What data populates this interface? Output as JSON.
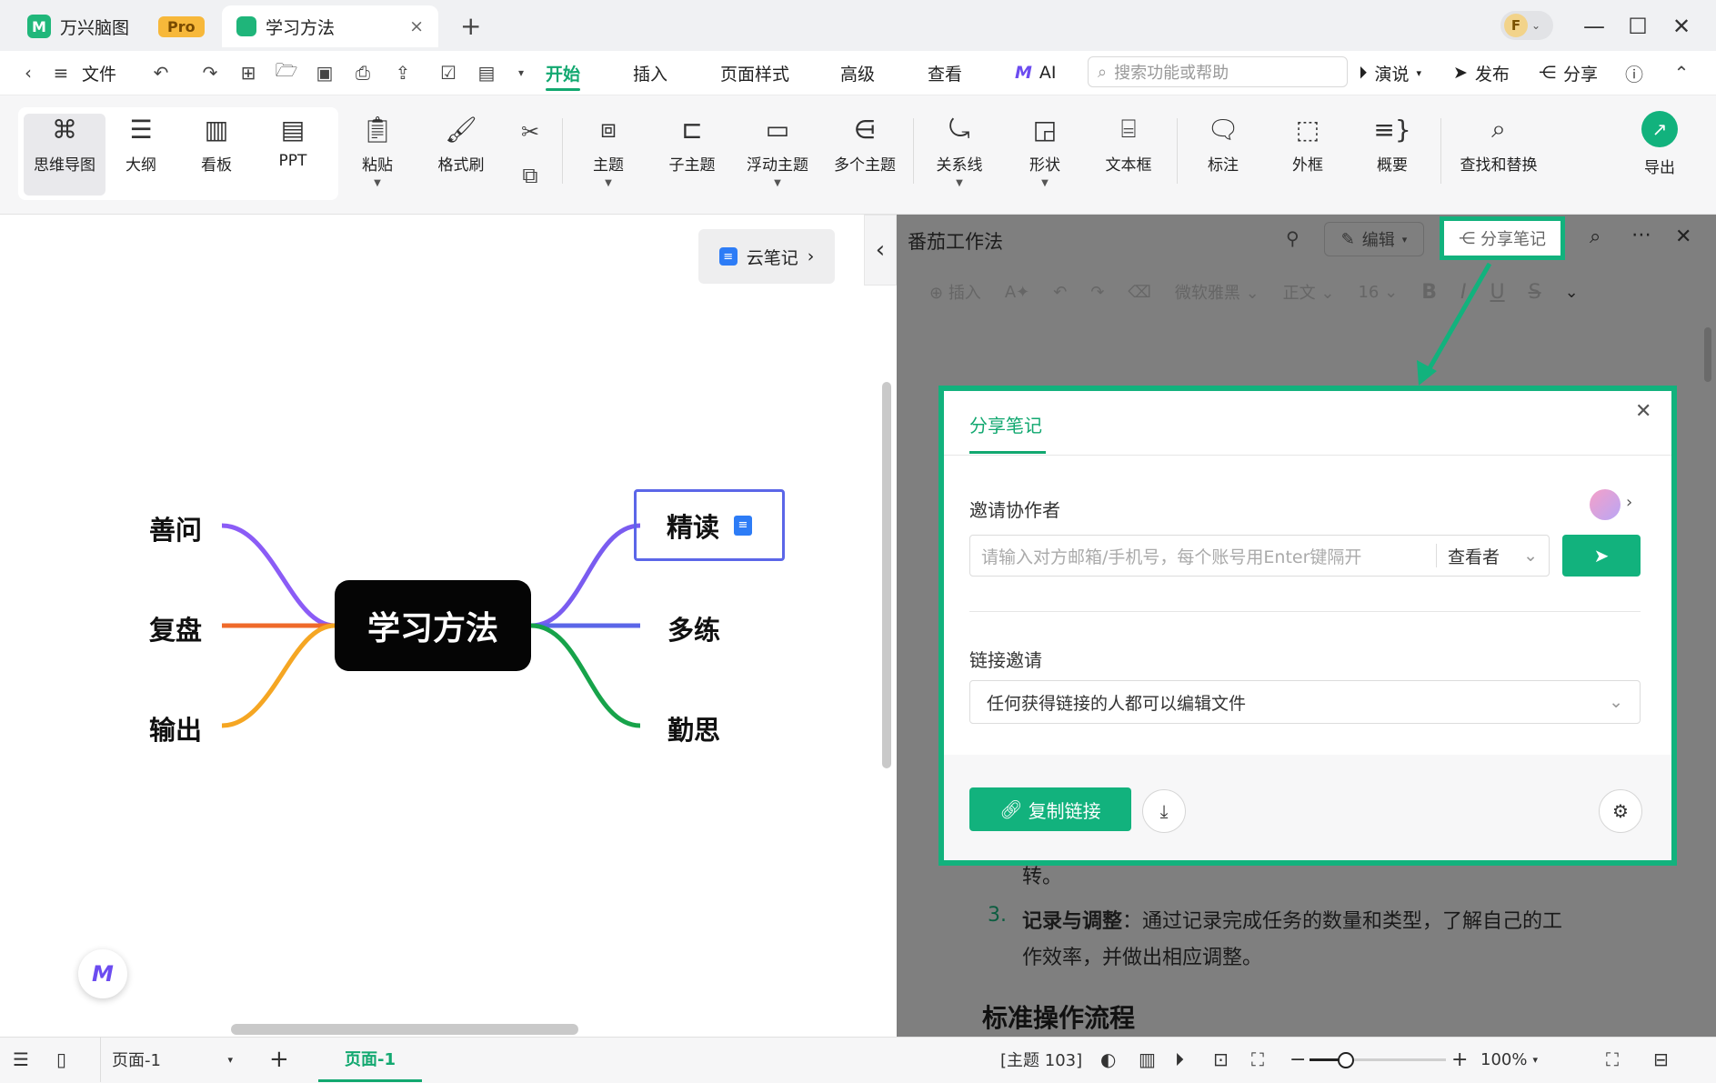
{
  "titlebar": {
    "app_name": "万兴脑图",
    "pro_badge": "Pro",
    "doc_tab": "学习方法",
    "close_tab": "×",
    "new_tab": "+",
    "avatar_letter": "F"
  },
  "menubar": {
    "file": "文件",
    "tabs": [
      "开始",
      "插入",
      "页面样式",
      "高级",
      "查看"
    ],
    "ai": "AI",
    "search_placeholder": "搜索功能或帮助",
    "present": "演说",
    "publish": "发布",
    "share": "分享"
  },
  "ribbon": {
    "views": [
      "思维导图",
      "大纲",
      "看板",
      "PPT"
    ],
    "paste": "粘贴",
    "format_painter": "格式刷",
    "topic": "主题",
    "subtopic": "子主题",
    "floating_topic": "浮动主题",
    "multiple_topics": "多个主题",
    "relationship": "关系线",
    "shape": "形状",
    "textbox": "文本框",
    "callout": "标注",
    "boundary": "外框",
    "summary": "概要",
    "find_replace": "查找和替换",
    "export": "导出"
  },
  "mindmap": {
    "root": "学习方法",
    "left": [
      "善问",
      "复盘",
      "输出"
    ],
    "right": [
      "精读",
      "多练",
      "勤思"
    ],
    "colors": {
      "shanwen": "#8b5cf6",
      "fupan": "#ef6a2a",
      "shuchu": "#f5a623",
      "jingdu": "#7a5cf0",
      "duolian": "#5b66e8",
      "qinsi": "#17a34a"
    }
  },
  "cloud_note_button": "云笔记",
  "note_panel": {
    "title": "番茄工作法",
    "edit": "编辑",
    "share_note": "分享笔记",
    "toolbar": {
      "insert": "插入",
      "font": "微软雅黑",
      "style": "正文",
      "size": "16"
    },
    "content": {
      "partial_line": "转。",
      "item_number": "3.",
      "item_bold": "记录与调整",
      "item_text_1": "：通过记录完成任务的数量和类型，了解自己的工",
      "item_text_2": "作效率，并做出相应调整。",
      "heading": "标准操作流程"
    }
  },
  "share_modal": {
    "tab": "分享笔记",
    "invite_label": "邀请协作者",
    "invite_placeholder": "请输入对方邮箱/手机号，每个账号用Enter键隔开",
    "role": "查看者",
    "link_label": "链接邀请",
    "link_option": "任何获得链接的人都可以编辑文件",
    "copy_link": "复制链接",
    "accent": "#12b27d"
  },
  "statusbar": {
    "page_select": "页面-1",
    "page_tab": "页面-1",
    "topic_count": "[主题 103]",
    "zoom": "100%",
    "zoom_level": 0.25
  }
}
